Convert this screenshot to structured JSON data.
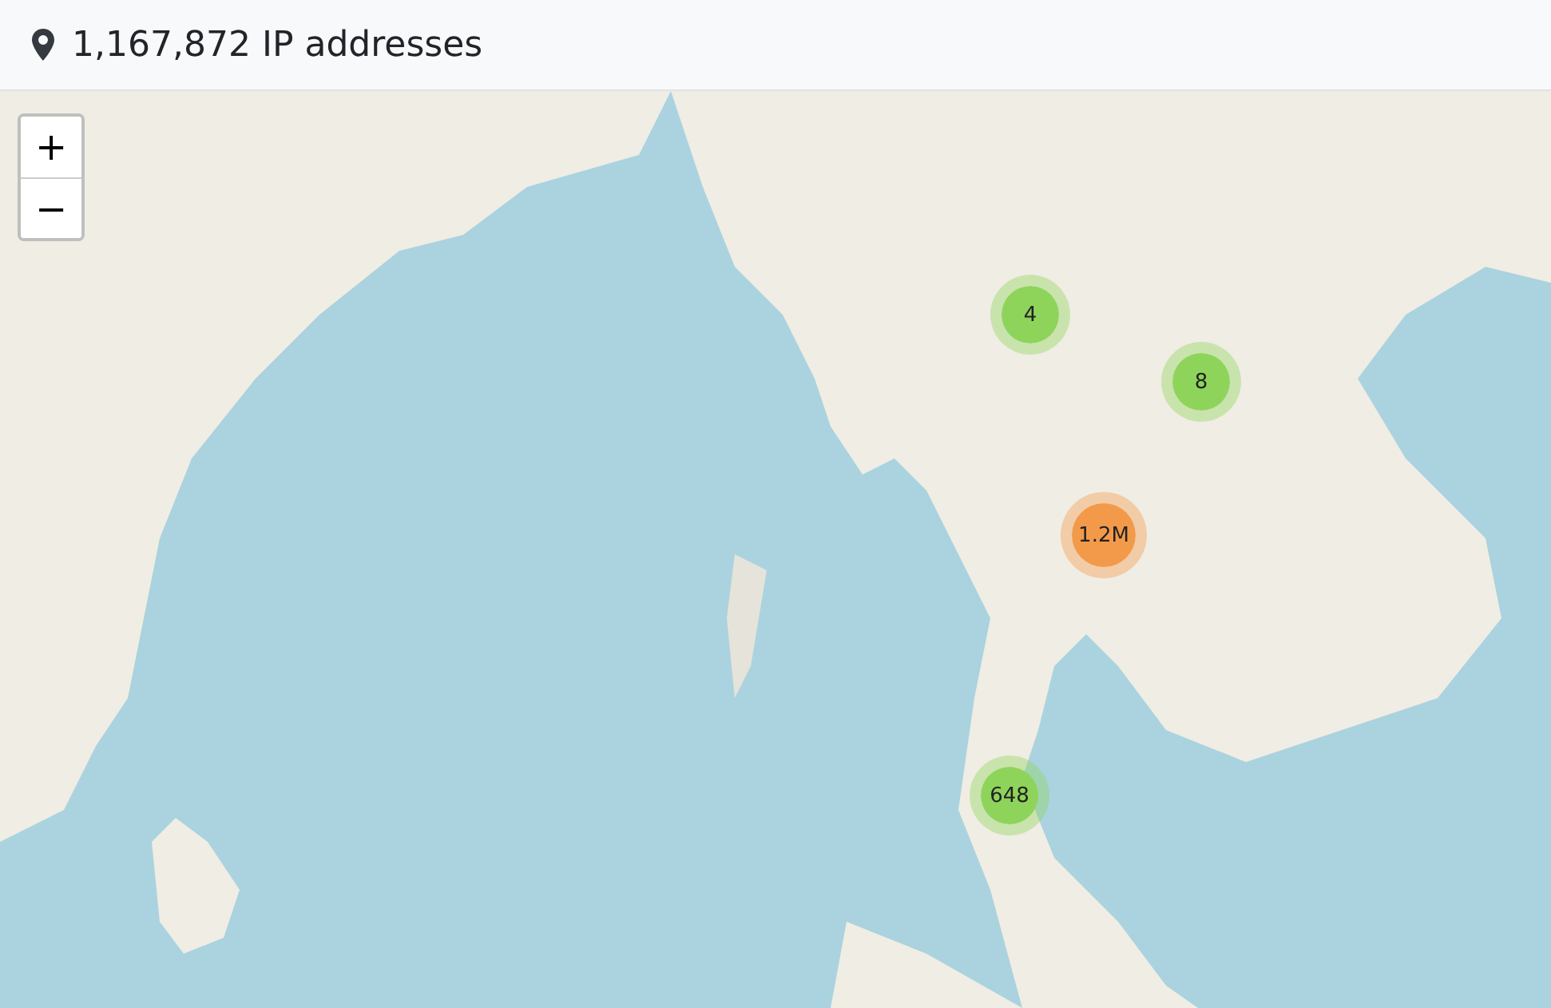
{
  "header": {
    "title": "1,167,872 IP addresses"
  },
  "zoom_controls": {
    "zoom_in": "+",
    "zoom_out": "−"
  },
  "map": {
    "clusters": [
      {
        "count": "4",
        "color": "#8ed45b"
      },
      {
        "count": "8",
        "color": "#8ed45b"
      },
      {
        "count": "1.2M",
        "color": "#f39a4a"
      },
      {
        "count": "648",
        "color": "#8ed45b"
      }
    ]
  }
}
